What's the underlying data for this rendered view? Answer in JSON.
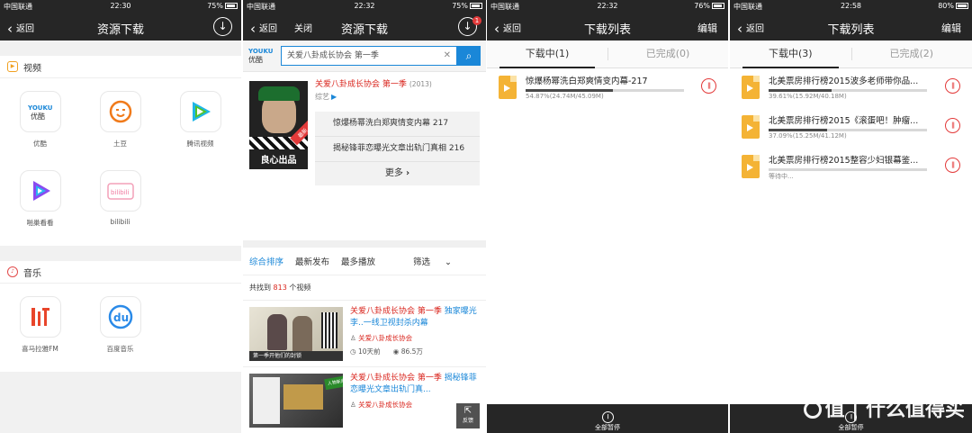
{
  "status_bars": [
    {
      "carrier": "中国联通",
      "time": "22:30",
      "battery": "75%",
      "battery_level": 0.75
    },
    {
      "carrier": "中国联通",
      "time": "22:32",
      "battery": "75%",
      "battery_level": 0.75
    },
    {
      "carrier": "中国联通",
      "time": "22:32",
      "battery": "76%",
      "battery_level": 0.76
    },
    {
      "carrier": "中国联通",
      "time": "22:58",
      "battery": "80%",
      "battery_level": 0.8
    }
  ],
  "screen1": {
    "back": "返回",
    "title": "资源下载",
    "video_section": {
      "title": "视频",
      "apps": [
        {
          "name": "优酷",
          "icon": "youku-logo-icon"
        },
        {
          "name": "土豆",
          "icon": "tudou-logo-icon"
        },
        {
          "name": "腾讯视频",
          "icon": "tencent-video-logo-icon"
        },
        {
          "name": "啪巢看看",
          "icon": "kankan-logo-icon"
        },
        {
          "name": "bilibili",
          "icon": "bilibili-logo-icon"
        }
      ]
    },
    "music_section": {
      "title": "音乐",
      "apps": [
        {
          "name": "喜马拉雅FM",
          "icon": "ximalaya-logo-icon"
        },
        {
          "name": "百度音乐",
          "icon": "baidu-music-logo-icon"
        }
      ]
    }
  },
  "screen2": {
    "back": "返回",
    "close": "关闭",
    "title": "资源下载",
    "badge": "1",
    "logo_top": "YOUKU",
    "logo_bottom": "优酷",
    "search_value": "关爱八卦成长协会 第一季",
    "show": {
      "title": "关爱八卦成长协会 第一季",
      "year": "(2013)",
      "type": "综艺",
      "poster_text": "良心出品",
      "poster_tag": "最新",
      "episodes": [
        {
          "num": "217",
          "text": "惊爆杨幂洗白郑爽情变内幕 217"
        },
        {
          "num": "216",
          "text": "揭秘锋菲恋曝光文章出轨门真相 216"
        }
      ],
      "more": "更多"
    },
    "sort": {
      "items": [
        "综合排序",
        "最新发布",
        "最多播放"
      ],
      "filter": "筛选"
    },
    "count_prefix": "共找到",
    "count_value": "813",
    "count_suffix": "个视频",
    "videos": [
      {
        "title_red": "关爱八卦成长协会 第一季 ",
        "title_blue": "独家曝光李..一线卫视封杀内幕",
        "author": "关爱八卦成长协会",
        "time": "10天前",
        "plays": "86.5万",
        "thumb_text": "第一季开他们的封锁"
      },
      {
        "title_red": "关爱八卦成长协会 第一季 ",
        "title_blue": "揭秘锋菲恋曝光文章出轨门真...",
        "author": "关爱八卦成长协会",
        "thumb_text": "人物新闻"
      }
    ],
    "feedback": "反馈"
  },
  "screen3": {
    "back": "返回",
    "title": "下载列表",
    "edit": "编辑",
    "tabs": [
      "下载中(1)",
      "已完成(0)"
    ],
    "items": [
      {
        "name": "惊爆杨幂洗白郑爽情变内幕-217",
        "info": "54.87%(24.74M/45.09M)",
        "progress": 0.5487
      }
    ],
    "pause_all": "全部暂停"
  },
  "screen4": {
    "back": "返回",
    "title": "下载列表",
    "edit": "编辑",
    "tabs": [
      "下载中(3)",
      "已完成(2)"
    ],
    "items": [
      {
        "name": "北美票房排行榜2015波多老师带你品...",
        "info": "39.61%(15.92M/40.18M)",
        "progress": 0.3961
      },
      {
        "name": "北美票房排行榜2015《滚蛋吧！肿瘤...",
        "info": "37.09%(15.25M/41.12M)",
        "progress": 0.3709
      },
      {
        "name": "北美票房排行榜2015整容少妇银幕鉴...",
        "info": "等待中...",
        "progress": 0
      }
    ],
    "pause_all": "全部暂停",
    "watermark": "值 | 什么值得买"
  }
}
